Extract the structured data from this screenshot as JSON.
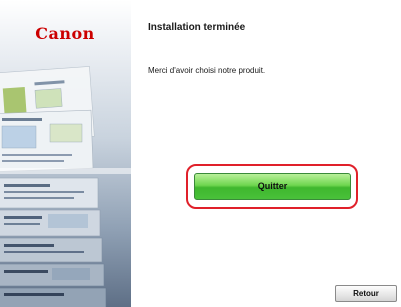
{
  "sidebar": {
    "logo_text": "Canon"
  },
  "main": {
    "title": "Installation terminée",
    "message": "Merci d'avoir choisi notre produit."
  },
  "buttons": {
    "quit_label": "Quitter",
    "back_label": "Retour"
  },
  "colors": {
    "brand": "#cc0000",
    "highlight": "#e0202a",
    "quit_button": "#4cc23a"
  }
}
